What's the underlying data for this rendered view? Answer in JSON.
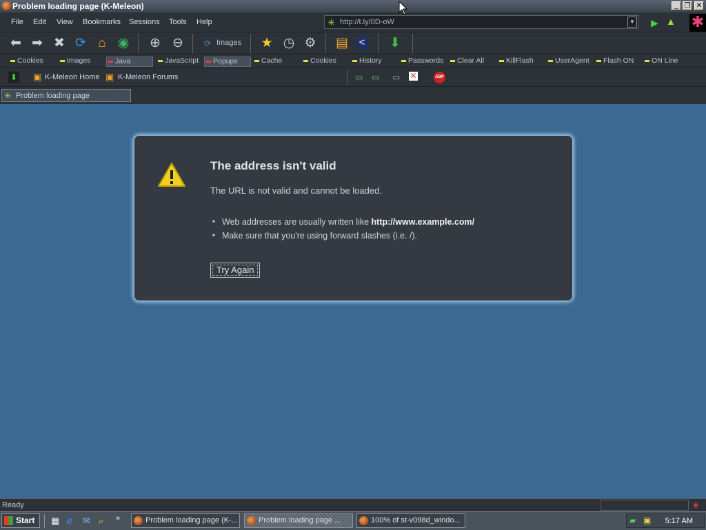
{
  "window": {
    "title": "Problem loading page (K-Meleon)"
  },
  "menu": [
    "File",
    "Edit",
    "View",
    "Bookmarks",
    "Sessions",
    "Tools",
    "Help"
  ],
  "address": {
    "value": "http://t.ly/0D-oW"
  },
  "toolbar": {
    "images_label": "Images"
  },
  "privacy": [
    {
      "label": "Cookies",
      "pressed": false
    },
    {
      "label": "Images",
      "pressed": false
    },
    {
      "label": "Java",
      "pressed": true
    },
    {
      "label": "JavaScript",
      "pressed": false
    },
    {
      "label": "Popups",
      "pressed": true
    },
    {
      "label": "Cache",
      "pressed": false
    },
    {
      "label": "Cookies",
      "pressed": false
    },
    {
      "label": "History",
      "pressed": false
    },
    {
      "label": "Passwords",
      "pressed": false
    },
    {
      "label": "Clear All",
      "pressed": false
    },
    {
      "label": "KillFlash",
      "pressed": false
    },
    {
      "label": "UserAgent",
      "pressed": false
    },
    {
      "label": "Flash ON",
      "pressed": false
    },
    {
      "label": "ON Line",
      "pressed": false
    }
  ],
  "bookmarks": [
    "K-Meleon Home",
    "K-Meleon Forums"
  ],
  "tab": {
    "label": "Problem loading page"
  },
  "error": {
    "title": "The address isn't valid",
    "desc": "The URL is not valid and cannot be loaded.",
    "bullet1_prefix": "Web addresses are usually written like ",
    "bullet1_bold": "http://www.example.com/",
    "bullet2": "Make sure that you're using forward slashes (i.e. /).",
    "button": "Try Again"
  },
  "status": {
    "text": "Ready"
  },
  "taskbar": {
    "start": "Start",
    "tasks": [
      "Problem loading page (K-...",
      "Problem loading page ...",
      "100% of st-v098d_windo..."
    ],
    "clock": "5:17 AM"
  },
  "colors": {
    "content_bg": "#3a6a94",
    "card_bg": "#353a42",
    "card_glow": "#b8d8f0"
  }
}
